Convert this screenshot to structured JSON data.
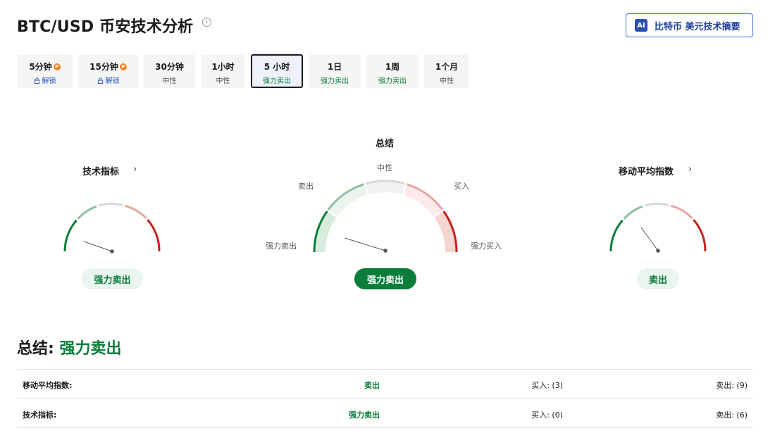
{
  "header": {
    "title": "BTC/USD 币安技术分析",
    "ai_button_badge": "AI",
    "ai_button_label": "比特币 美元技术摘要"
  },
  "timeframes": [
    {
      "label": "5分钟",
      "sub": "解锁",
      "locked": true
    },
    {
      "label": "15分钟",
      "sub": "解锁",
      "locked": true
    },
    {
      "label": "30分钟",
      "sub": "中性"
    },
    {
      "label": "1小时",
      "sub": "中性"
    },
    {
      "label": "5 小时",
      "sub": "强力卖出",
      "active": true
    },
    {
      "label": "1日",
      "sub": "强力卖出"
    },
    {
      "label": "1周",
      "sub": "强力卖出"
    },
    {
      "label": "1个月",
      "sub": "中性"
    }
  ],
  "gauges": {
    "technical": {
      "title": "技术指标",
      "result": "强力卖出"
    },
    "summary": {
      "title": "总结",
      "result": "强力卖出",
      "scale": {
        "neutral": "中性",
        "sell": "卖出",
        "buy": "买入",
        "strong_sell": "强力卖出",
        "strong_buy": "强力买入"
      }
    },
    "moving_averages": {
      "title": "移动平均指数",
      "result": "卖出"
    }
  },
  "summary": {
    "label": "总结:",
    "value": "强力卖出"
  },
  "table": [
    {
      "name": "移动平均指数:",
      "signal": "卖出",
      "buy": "买入: (3)",
      "sell": "卖出: (9)"
    },
    {
      "name": "技术指标:",
      "signal": "强力卖出",
      "buy": "买入: (0)",
      "sell": "卖出: (6)"
    }
  ],
  "colors": {
    "strong_sell": "#0a7d3a",
    "sell": "#8fbf9e",
    "neutral": "#d8d8d8",
    "buy": "#e8a4a0",
    "strong_buy": "#c8201c",
    "accent": "#2a4fae"
  }
}
